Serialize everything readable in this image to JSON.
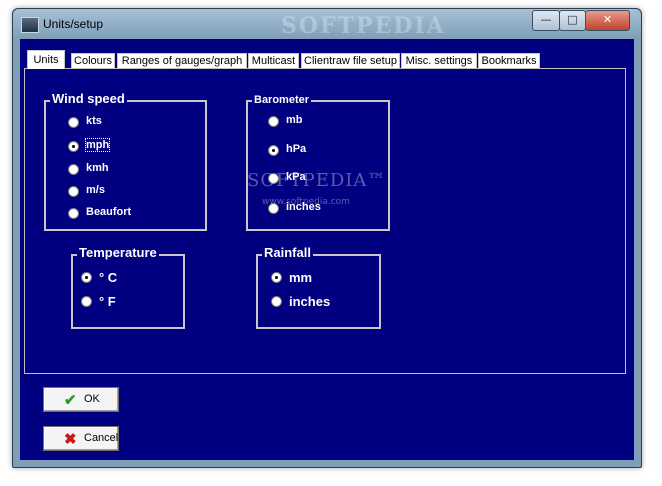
{
  "window": {
    "title": "Units/setup",
    "watermark": "SOFTPEDIA",
    "minimize_glyph": "—",
    "maximize_glyph": "□",
    "close_glyph": "✕"
  },
  "tabs": [
    {
      "label": "Units",
      "active": true
    },
    {
      "label": "Colours"
    },
    {
      "label": "Ranges of gauges/graph"
    },
    {
      "label": "Multicast"
    },
    {
      "label": "Clientraw file setup"
    },
    {
      "label": "Misc. settings"
    },
    {
      "label": "Bookmarks"
    }
  ],
  "groups": {
    "wind_speed": {
      "title": "Wind speed",
      "options": [
        {
          "label": "kts"
        },
        {
          "label": "mph",
          "selected": true
        },
        {
          "label": "kmh"
        },
        {
          "label": "m/s"
        },
        {
          "label": "Beaufort"
        }
      ]
    },
    "barometer": {
      "title": "Barometer",
      "options": [
        {
          "label": "mb"
        },
        {
          "label": "hPa",
          "selected": true
        },
        {
          "label": "kPa"
        },
        {
          "label": "inches"
        }
      ]
    },
    "temperature": {
      "title": "Temperature",
      "options": [
        {
          "label": "° C",
          "selected": true
        },
        {
          "label": "° F"
        }
      ]
    },
    "rainfall": {
      "title": "Rainfall",
      "options": [
        {
          "label": "mm",
          "selected": true
        },
        {
          "label": "inches"
        }
      ]
    }
  },
  "overlay": {
    "softpedia": "SOFTPEDIA™",
    "softpedia_url": "www.softpedia.com"
  },
  "buttons": {
    "ok": {
      "label": "OK",
      "icon": "checkmark-icon"
    },
    "cancel": {
      "label": "Cancel",
      "icon": "x-icon"
    }
  }
}
